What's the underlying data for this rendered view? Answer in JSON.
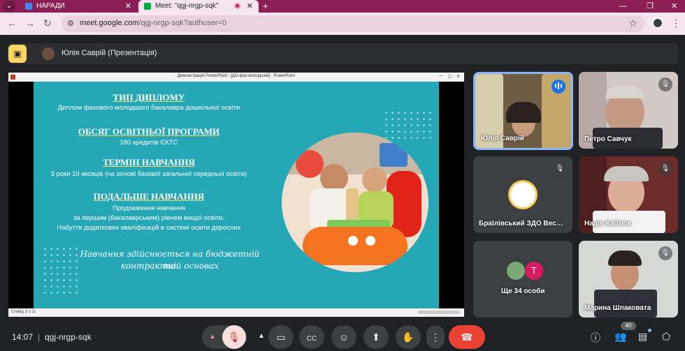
{
  "browser": {
    "tabs": [
      {
        "title": "НАРАДИ"
      },
      {
        "title": "Meet: \"qgj-nrgp-sqk\""
      }
    ],
    "url_host": "meet.google.com",
    "url_path": "/qgj-nrgp-sqk?authuser=0"
  },
  "presentation": {
    "presenter_label": "Юлія Саврій (Презентація)"
  },
  "slide": {
    "window_title": "Демонстрація PowerPoint - [ДО-фах.молодший] - PowerPoint",
    "status": "Слайд 3 з 11",
    "sections": [
      {
        "heading": "ТИП ДИПЛОМУ",
        "lines": [
          "Диплом фахового молодшого бакалавра дошкільної освіти"
        ]
      },
      {
        "heading": "ОБСЯГ ОСВІТНЬОЇ ПРОГРАМИ",
        "lines": [
          "180 кредитів ЄКТС"
        ]
      },
      {
        "heading": "ТЕРМІН НАВЧАННЯ",
        "lines": [
          "3 роки 10 місяців (на основі базової загальної середньої освіти)"
        ]
      },
      {
        "heading": "ПОДАЛЬШЕ НАВЧАННЯ",
        "lines": [
          "Продовження навчання",
          "за першим (бакалаврським) рівнем вищої освіти.",
          "Набуття додаткових кваліфікацій в системі освіти дорослих"
        ]
      }
    ],
    "script_line1": "Навчання здійснюється на бюджетній та",
    "script_line2": "контрактній основах"
  },
  "participants": [
    {
      "name": "Юлія Саврій",
      "state": "speaking"
    },
    {
      "name": "Петро Савчук",
      "state": "muted"
    },
    {
      "name": "Браїлівський ЗДО Вес…",
      "state": "muted"
    },
    {
      "name": "Надія Кабзюк",
      "state": "muted"
    },
    {
      "name": "Ще 34 особи",
      "state": "",
      "avatar_letter": "T"
    },
    {
      "name": "Марина Шпаковата",
      "state": "muted"
    }
  ],
  "controls": {
    "time": "14:07",
    "meeting_code": "qgj-nrgp-sqk",
    "participant_count": "40"
  },
  "colors": {
    "accent_blue": "#8ab4f8",
    "end_call": "#ea4335",
    "slide_bg": "#26a7b5",
    "tab_strip": "#8a1e55"
  }
}
